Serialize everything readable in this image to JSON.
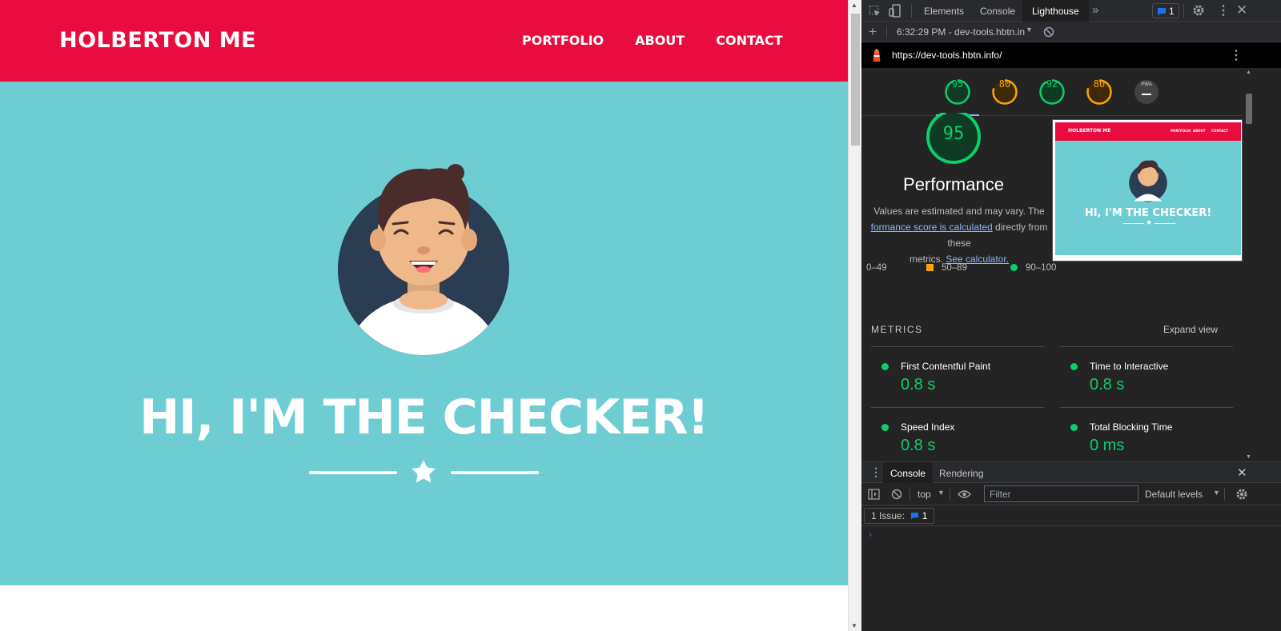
{
  "site": {
    "brand": "HOLBERTON ME",
    "nav": [
      "PORTFOLIO",
      "ABOUT",
      "CONTACT"
    ],
    "hero_title": "HI, I'M THE CHECKER!",
    "colors": {
      "navbar": "#e90c3e",
      "hero": "#6dcdd3",
      "avatar_bg": "#2a3d52"
    }
  },
  "devtools": {
    "tabs": [
      "Elements",
      "Console",
      "Lighthouse"
    ],
    "active_tab": "Lighthouse",
    "issues_count": "1",
    "lighthouse": {
      "report_select": "6:32:29 PM - dev-tools.hbtn.in",
      "url": "https://dev-tools.hbtn.info/",
      "gauges": [
        {
          "score": "95",
          "color": "#0cce6b"
        },
        {
          "score": "80",
          "color": "#ffa400"
        },
        {
          "score": "92",
          "color": "#0cce6b"
        },
        {
          "score": "80",
          "color": "#ffa400"
        },
        {
          "score": "PWA",
          "color": "#9e9e9e"
        }
      ],
      "performance": {
        "score": "95",
        "title": "Performance",
        "desc_line1": "Values are estimated and may vary. The",
        "desc_link": "formance score is calculated",
        "desc_line2_rest": " directly from these",
        "desc_line3_prefix": "metrics. ",
        "desc_link2": "See calculator."
      },
      "legend": [
        "0–49",
        "50–89",
        "90–100"
      ],
      "metrics_header": "METRICS",
      "expand_view": "Expand view",
      "metrics": [
        {
          "label": "First Contentful Paint",
          "value": "0.8 s"
        },
        {
          "label": "Time to Interactive",
          "value": "0.8 s"
        },
        {
          "label": "Speed Index",
          "value": "0.8 s"
        },
        {
          "label": "Total Blocking Time",
          "value": "0 ms"
        }
      ],
      "thumbnail": {
        "brand": "HOLBERTON ME",
        "nav": [
          "PORTFOLIO",
          "ABOUT",
          "CONTACT"
        ],
        "title": "HI, I'M THE CHECKER!"
      }
    },
    "drawer": {
      "tabs": [
        "Console",
        "Rendering"
      ],
      "context": "top",
      "filter_placeholder": "Filter",
      "levels": "Default levels",
      "issue_label": "1 Issue:",
      "issue_count": "1"
    }
  }
}
